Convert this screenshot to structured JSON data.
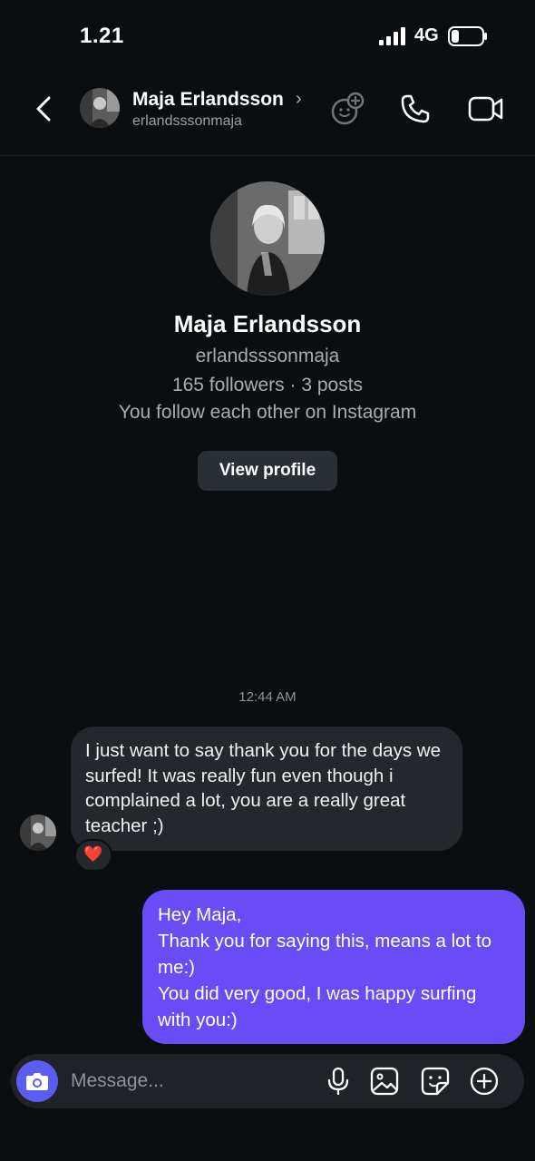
{
  "status": {
    "time": "1.21",
    "network": "4G"
  },
  "header": {
    "name": "Maja Erlandsson",
    "username": "erlandsssonmaja"
  },
  "profile": {
    "name": "Maja Erlandsson",
    "username": "erlandsssonmaja",
    "stats": "165 followers · 3 posts",
    "mutual": "You follow each other on Instagram",
    "view_profile_label": "View profile"
  },
  "conversation": {
    "timestamp": "12:44 AM",
    "messages": [
      {
        "direction": "incoming",
        "text": "I just want to say thank you for the days we surfed! It was really fun even though i complained a lot, you are a really great teacher ;)",
        "reaction": "❤️"
      },
      {
        "direction": "outgoing",
        "text": "Hey Maja,\nThank you for saying this, means a lot to me:)\nYou did very good, I was happy surfing with you:)"
      }
    ]
  },
  "composer": {
    "placeholder": "Message..."
  },
  "colors": {
    "background": "#0b0e11",
    "outgoing_bubble": "#6a4cf6",
    "incoming_bubble": "#24282d",
    "camera_button": "#5b5cf0"
  },
  "icons": [
    "back-icon",
    "emoji-icon",
    "phone-icon",
    "video-icon",
    "camera-icon",
    "mic-icon",
    "gallery-icon",
    "sticker-icon",
    "plus-icon"
  ]
}
